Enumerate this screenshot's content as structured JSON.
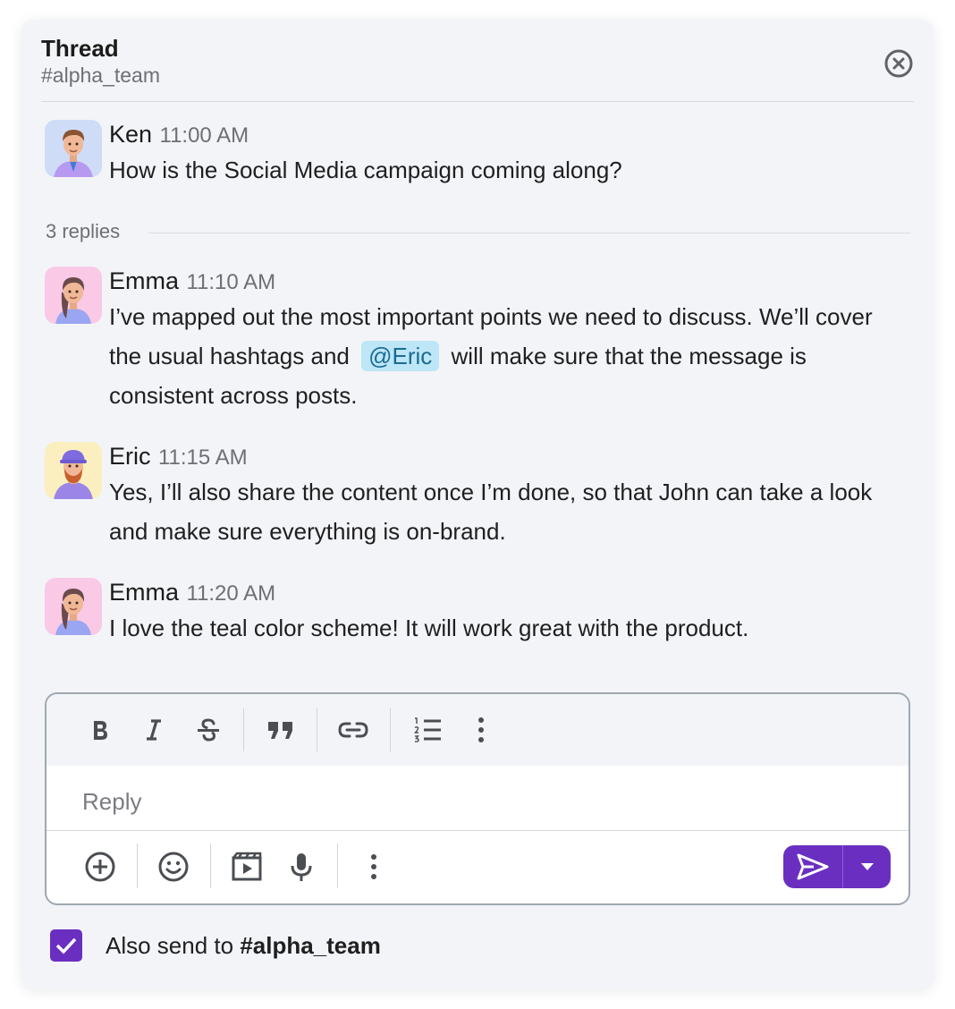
{
  "header": {
    "title": "Thread",
    "channel": "#alpha_team"
  },
  "parent_message": {
    "author": "Ken",
    "time": "11:00 AM",
    "text": "How is the Social Media campaign coming along?"
  },
  "replies_label": "3 replies",
  "replies": [
    {
      "author": "Emma",
      "time": "11:10 AM",
      "text_before": "I’ve mapped out the most important points we need to discuss. We’ll cover the usual hashtags and",
      "mention": "@Eric",
      "text_after": "will make sure that the message is consistent across posts."
    },
    {
      "author": "Eric",
      "time": "11:15 AM",
      "text": "Yes, I’ll also share the content once I’m done, so that John can take a look and make sure everything is on-brand."
    },
    {
      "author": "Emma",
      "time": "11:20 AM",
      "text": "I love the teal color scheme! It will work great with the product."
    }
  ],
  "composer": {
    "placeholder": "Reply",
    "format_icons": [
      "bold-icon",
      "italic-icon",
      "strikethrough-icon",
      "quote-icon",
      "link-icon",
      "numbered-list-icon",
      "more-vertical-icon"
    ],
    "action_icons": [
      "add-circle-icon",
      "emoji-icon",
      "video-clip-icon",
      "microphone-icon",
      "more-vertical-icon"
    ]
  },
  "also_send": {
    "prefix": "Also send to ",
    "channel": "#alpha_team",
    "checked": true
  },
  "colors": {
    "accent": "#6a2fc0",
    "panel_bg": "#f3f4f8",
    "mention_bg": "#bde6f7",
    "mention_text": "#1b6b92",
    "avatar_ken_bg": "#cfdcf8",
    "avatar_emma_bg": "#f9c9e6",
    "avatar_eric_bg": "#fbefbf"
  }
}
